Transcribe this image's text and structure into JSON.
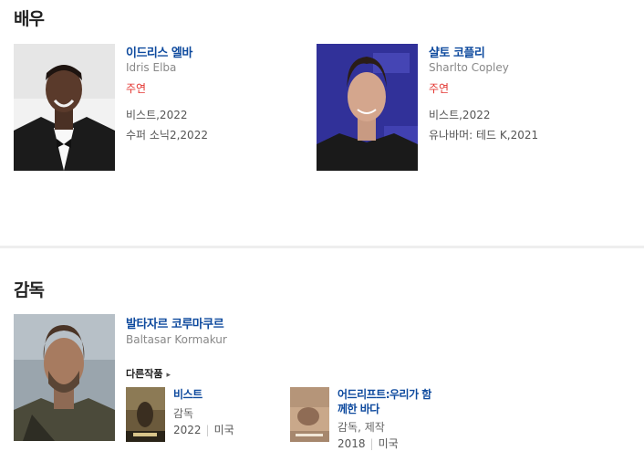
{
  "sections": {
    "actors_title": "배우",
    "director_title": "감독"
  },
  "actors": [
    {
      "name_ko": "이드리스 엘바",
      "name_en": "Idris Elba",
      "role": "주연",
      "works": [
        "비스트,2022",
        "수퍼 소닉2,2022"
      ]
    },
    {
      "name_ko": "샬토 코플리",
      "name_en": "Sharlto Copley",
      "role": "주연",
      "works": [
        "비스트,2022",
        "유나바머: 테드 K,2021"
      ]
    }
  ],
  "director": {
    "name_ko": "발타자르 코루마쿠르",
    "name_en": "Baltasar Kormakur",
    "more_works_label": "다른작품",
    "films": [
      {
        "title": "비스트",
        "role": "감독",
        "year": "2022",
        "country": "미국"
      },
      {
        "title": "어드리프트:우리가 함께한 바다",
        "role": "감독, 제작",
        "year": "2018",
        "country": "미국"
      }
    ]
  },
  "colors": {
    "link": "#0e4a9e",
    "role": "#e3342f",
    "divider": "#eeeeee"
  }
}
